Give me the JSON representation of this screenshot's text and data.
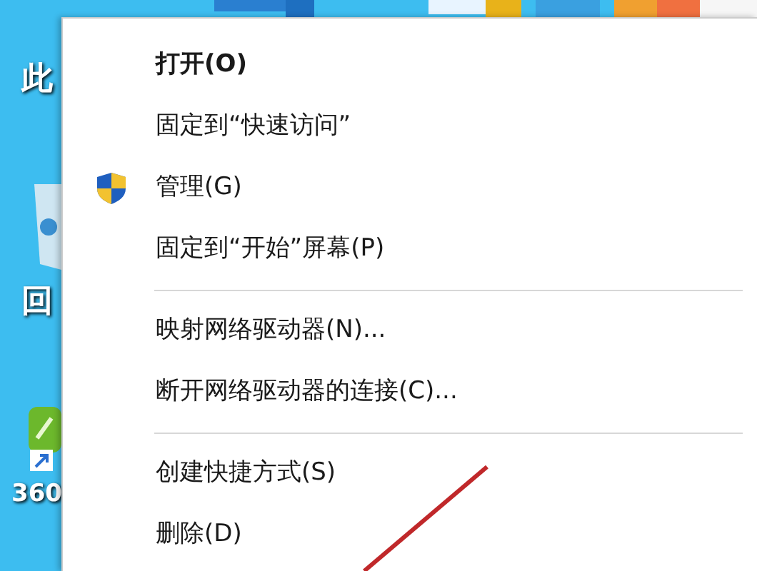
{
  "desktop_icons": [
    {
      "label": "此"
    },
    {
      "label": "回"
    },
    {
      "label": "360"
    }
  ],
  "context_menu": {
    "items": [
      {
        "kind": "item",
        "label": "打开(O)",
        "default": true
      },
      {
        "kind": "item",
        "label": "固定到“快速访问”",
        "default": false
      },
      {
        "kind": "shield_item",
        "label": "管理(G)",
        "default": false
      },
      {
        "kind": "item",
        "label": "固定到“开始”屏幕(P)",
        "default": false
      },
      {
        "kind": "separator"
      },
      {
        "kind": "item",
        "label": "映射网络驱动器(N)...",
        "default": false
      },
      {
        "kind": "item",
        "label": "断开网络驱动器的连接(C)...",
        "default": false
      },
      {
        "kind": "separator"
      },
      {
        "kind": "item",
        "label": "创建快捷方式(S)",
        "default": false
      },
      {
        "kind": "item",
        "label": "删除(D)",
        "default": false
      }
    ]
  }
}
